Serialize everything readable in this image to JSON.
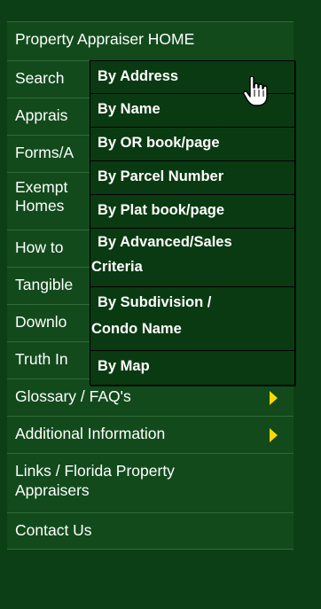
{
  "menu": {
    "items": [
      {
        "label": "Property Appraiser HOME",
        "has_submenu": false
      },
      {
        "label": "Search",
        "has_submenu": true
      },
      {
        "label": "Apprais",
        "has_submenu": false
      },
      {
        "label": "Forms/A",
        "has_submenu": false
      },
      {
        "label": "Exempt\nHomes",
        "has_submenu": false
      },
      {
        "label": "How to",
        "has_submenu": false
      },
      {
        "label": "Tangible",
        "has_submenu": false
      },
      {
        "label": "Downlo",
        "has_submenu": false
      },
      {
        "label": "Truth In",
        "has_submenu": false
      },
      {
        "label": "Glossary / FAQ's",
        "has_submenu": true
      },
      {
        "label": "Additional Information",
        "has_submenu": true
      },
      {
        "label": "Links / Florida Property\nAppraisers",
        "has_submenu": false
      },
      {
        "label": "Contact Us",
        "has_submenu": false
      }
    ]
  },
  "search_submenu": {
    "items": [
      {
        "line1": "By Address",
        "line2": ""
      },
      {
        "line1": "By Name",
        "line2": ""
      },
      {
        "line1": "By OR book/page",
        "line2": ""
      },
      {
        "line1": "By Parcel Number",
        "line2": ""
      },
      {
        "line1": "By Plat book/page",
        "line2": ""
      },
      {
        "line1": "By Advanced/Sales",
        "line2": "Criteria"
      },
      {
        "line1": "By Subdivision /",
        "line2": "Condo Name"
      },
      {
        "line1": "By Map",
        "line2": ""
      }
    ]
  },
  "colors": {
    "background": "#0d3f16",
    "menu_item_bg": "#124a1c",
    "submenu_bg": "#0a3a12",
    "arrow": "#ffd800",
    "text": "#ffffff"
  },
  "icons": {
    "submenu_arrow": "triangle-right-icon",
    "cursor": "hand-pointer-icon"
  }
}
